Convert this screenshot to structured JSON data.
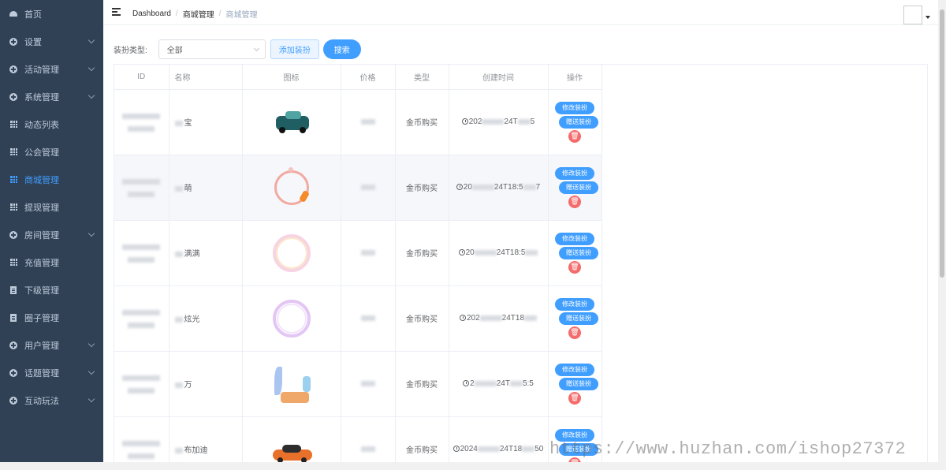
{
  "sidebar": {
    "items": [
      {
        "label": "首页",
        "icon": "dashboard-icon",
        "active": false,
        "expandable": false
      },
      {
        "label": "设置",
        "icon": "plus-circle-icon",
        "active": false,
        "expandable": true
      },
      {
        "label": "活动管理",
        "icon": "plus-circle-icon",
        "active": false,
        "expandable": true
      },
      {
        "label": "系统管理",
        "icon": "plus-circle-icon",
        "active": false,
        "expandable": true
      },
      {
        "label": "动态列表",
        "icon": "table-icon",
        "active": false,
        "expandable": false
      },
      {
        "label": "公会管理",
        "icon": "table-icon",
        "active": false,
        "expandable": false
      },
      {
        "label": "商城管理",
        "icon": "table-icon",
        "active": true,
        "expandable": false
      },
      {
        "label": "提现管理",
        "icon": "table-icon",
        "active": false,
        "expandable": false
      },
      {
        "label": "房间管理",
        "icon": "plus-circle-icon",
        "active": false,
        "expandable": true
      },
      {
        "label": "充值管理",
        "icon": "table-icon",
        "active": false,
        "expandable": false
      },
      {
        "label": "下级管理",
        "icon": "document-icon",
        "active": false,
        "expandable": false
      },
      {
        "label": "圈子管理",
        "icon": "document-icon",
        "active": false,
        "expandable": false
      },
      {
        "label": "用户管理",
        "icon": "plus-circle-icon",
        "active": false,
        "expandable": true
      },
      {
        "label": "话题管理",
        "icon": "plus-circle-icon",
        "active": false,
        "expandable": true
      },
      {
        "label": "互动玩法",
        "icon": "plus-circle-icon",
        "active": false,
        "expandable": true
      }
    ]
  },
  "breadcrumb": [
    "Dashboard",
    "商城管理",
    "商城管理"
  ],
  "filter": {
    "label": "装扮类型:",
    "select_value": "全部",
    "add_button": "添加装扮",
    "search_button": "搜索"
  },
  "table": {
    "headers": [
      "ID",
      "名称",
      "图标",
      "价格",
      "类型",
      "创建时间",
      "操作"
    ],
    "rows": [
      {
        "name": "宝",
        "type": "金币购买",
        "time": "202",
        "time_mid": "24T",
        "time_end": "5",
        "img": "car-green"
      },
      {
        "name": "萌",
        "type": "金币购买",
        "time": "20",
        "time_mid": "24T18:5",
        "time_end": "7",
        "img": "frame-carrot"
      },
      {
        "name": "满满",
        "type": "金币购买",
        "time": "20",
        "time_mid": "24T18:5",
        "time_end": "",
        "img": "frame-pink"
      },
      {
        "name": "炫光",
        "type": "金币购买",
        "time": "202",
        "time_mid": "24T18",
        "time_end": "",
        "img": "frame-purple"
      },
      {
        "name": "万",
        "type": "金币购买",
        "time": "2",
        "time_mid": "24T",
        "time_end": "5:5",
        "img": "frame-laurel"
      },
      {
        "name": "布加迪",
        "type": "金币购买",
        "time": "2024",
        "time_mid": "24T18",
        "time_end": "50",
        "img": "car-orange"
      }
    ],
    "edit_label": "修改装扮",
    "gift_label": "赠送装扮",
    "delete_icon": "trash-icon"
  },
  "watermark": "https://www.huzhan.com/ishop27372",
  "colors": {
    "sidebar_bg": "#304156",
    "primary": "#409eff",
    "danger": "#f56c6c"
  }
}
